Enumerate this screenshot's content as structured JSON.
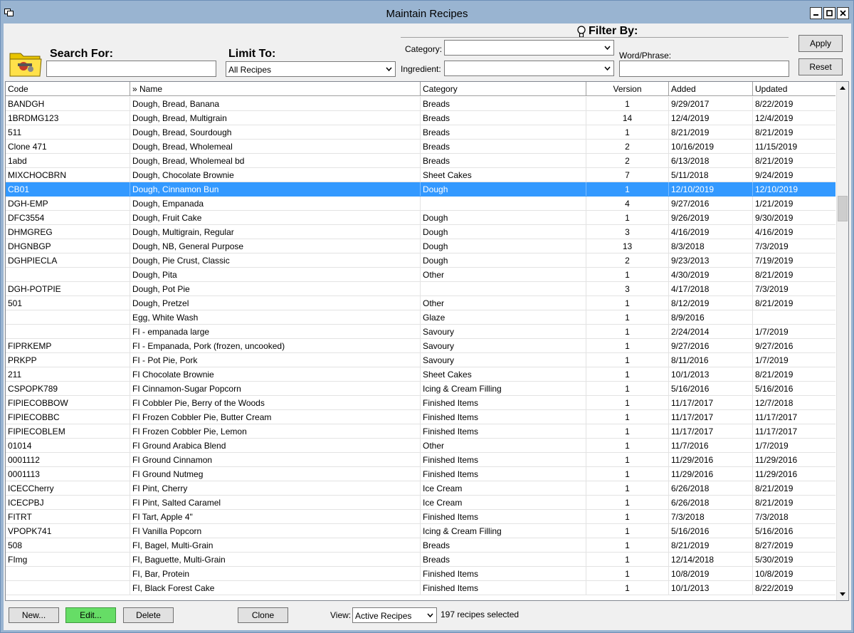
{
  "window": {
    "title": "Maintain Recipes"
  },
  "search": {
    "label": "Search For:",
    "value": ""
  },
  "limit": {
    "label": "Limit To:",
    "value": "All Recipes"
  },
  "filter": {
    "title": "Filter By:",
    "category_label": "Category:",
    "category_value": "",
    "ingredient_label": "Ingredient:",
    "ingredient_value": "",
    "word_label": "Word/Phrase:",
    "word_value": ""
  },
  "buttons": {
    "apply": "Apply",
    "reset": "Reset",
    "new": "New...",
    "edit": "Edit...",
    "delete": "Delete",
    "clone": "Clone"
  },
  "columns": {
    "code": "Code",
    "name": "» Name",
    "category": "Category",
    "version": "Version",
    "added": "Added",
    "updated": "Updated"
  },
  "rows": [
    {
      "code": "BANDGH",
      "name": "Dough, Bread, Banana",
      "category": "Breads",
      "version": "1",
      "added": "9/29/2017",
      "updated": "8/22/2019"
    },
    {
      "code": "1BRDMG123",
      "name": "Dough, Bread, Multigrain",
      "category": "Breads",
      "version": "14",
      "added": "12/4/2019",
      "updated": "12/4/2019"
    },
    {
      "code": "511",
      "name": "Dough, Bread, Sourdough",
      "category": "Breads",
      "version": "1",
      "added": "8/21/2019",
      "updated": "8/21/2019"
    },
    {
      "code": "Clone 471",
      "name": "Dough, Bread, Wholemeal",
      "category": "Breads",
      "version": "2",
      "added": "10/16/2019",
      "updated": "11/15/2019"
    },
    {
      "code": "1abd",
      "name": "Dough, Bread, Wholemeal bd",
      "category": "Breads",
      "version": "2",
      "added": "6/13/2018",
      "updated": "8/21/2019"
    },
    {
      "code": "MIXCHOCBRN",
      "name": "Dough, Chocolate Brownie",
      "category": "Sheet Cakes",
      "version": "7",
      "added": "5/11/2018",
      "updated": "9/24/2019"
    },
    {
      "code": "CB01",
      "name": "Dough, Cinnamon Bun",
      "category": "Dough",
      "version": "1",
      "added": "12/10/2019",
      "updated": "12/10/2019",
      "selected": true
    },
    {
      "code": "DGH-EMP",
      "name": "Dough, Empanada",
      "category": "",
      "version": "4",
      "added": "9/27/2016",
      "updated": "1/21/2019"
    },
    {
      "code": "DFC3554",
      "name": "Dough, Fruit Cake",
      "category": "Dough",
      "version": "1",
      "added": "9/26/2019",
      "updated": "9/30/2019"
    },
    {
      "code": "DHMGREG",
      "name": "Dough, Multigrain, Regular",
      "category": "Dough",
      "version": "3",
      "added": "4/16/2019",
      "updated": "4/16/2019"
    },
    {
      "code": "DHGNBGP",
      "name": "Dough, NB, General Purpose",
      "category": "Dough",
      "version": "13",
      "added": "8/3/2018",
      "updated": "7/3/2019"
    },
    {
      "code": "DGHPIECLA",
      "name": "Dough, Pie Crust, Classic",
      "category": "Dough",
      "version": "2",
      "added": "9/23/2013",
      "updated": "7/19/2019"
    },
    {
      "code": "",
      "name": "Dough, Pita",
      "category": "Other",
      "version": "1",
      "added": "4/30/2019",
      "updated": "8/21/2019"
    },
    {
      "code": "DGH-POTPIE",
      "name": "Dough, Pot Pie",
      "category": "",
      "version": "3",
      "added": "4/17/2018",
      "updated": "7/3/2019"
    },
    {
      "code": "501",
      "name": "Dough, Pretzel",
      "category": "Other",
      "version": "1",
      "added": "8/12/2019",
      "updated": "8/21/2019"
    },
    {
      "code": "",
      "name": "Egg, White Wash",
      "category": "Glaze",
      "version": "1",
      "added": "8/9/2016",
      "updated": ""
    },
    {
      "code": "",
      "name": "FI - empanada large",
      "category": "Savoury",
      "version": "1",
      "added": "2/24/2014",
      "updated": "1/7/2019"
    },
    {
      "code": "FIPRKEMP",
      "name": "FI - Empanada, Pork (frozen, uncooked)",
      "category": "Savoury",
      "version": "1",
      "added": "9/27/2016",
      "updated": "9/27/2016"
    },
    {
      "code": "PRKPP",
      "name": "FI - Pot Pie, Pork",
      "category": "Savoury",
      "version": "1",
      "added": "8/11/2016",
      "updated": "1/7/2019"
    },
    {
      "code": "211",
      "name": "FI Chocolate Brownie",
      "category": "Sheet Cakes",
      "version": "1",
      "added": "10/1/2013",
      "updated": "8/21/2019"
    },
    {
      "code": "CSPOPK789",
      "name": "FI Cinnamon-Sugar Popcorn",
      "category": "Icing & Cream Filling",
      "version": "1",
      "added": "5/16/2016",
      "updated": "5/16/2016"
    },
    {
      "code": "FIPIECOBBOW",
      "name": "FI Cobbler Pie, Berry of the Woods",
      "category": "Finished Items",
      "version": "1",
      "added": "11/17/2017",
      "updated": "12/7/2018"
    },
    {
      "code": "FIPIECOBBC",
      "name": "FI Frozen Cobbler Pie, Butter Cream",
      "category": "Finished Items",
      "version": "1",
      "added": "11/17/2017",
      "updated": "11/17/2017"
    },
    {
      "code": "FIPIECOBLEM",
      "name": "FI Frozen Cobbler Pie, Lemon",
      "category": "Finished Items",
      "version": "1",
      "added": "11/17/2017",
      "updated": "11/17/2017"
    },
    {
      "code": "01014",
      "name": "FI Ground Arabica Blend",
      "category": "Other",
      "version": "1",
      "added": "11/7/2016",
      "updated": "1/7/2019"
    },
    {
      "code": "0001112",
      "name": "FI Ground Cinnamon",
      "category": "Finished Items",
      "version": "1",
      "added": "11/29/2016",
      "updated": "11/29/2016"
    },
    {
      "code": "0001113",
      "name": "FI Ground Nutmeg",
      "category": "Finished Items",
      "version": "1",
      "added": "11/29/2016",
      "updated": "11/29/2016"
    },
    {
      "code": "ICECCherry",
      "name": "FI Pint, Cherry",
      "category": "Ice Cream",
      "version": "1",
      "added": "6/26/2018",
      "updated": "8/21/2019"
    },
    {
      "code": "ICECPBJ",
      "name": "FI Pint, Salted Caramel",
      "category": "Ice Cream",
      "version": "1",
      "added": "6/26/2018",
      "updated": "8/21/2019"
    },
    {
      "code": "FITRT",
      "name": "FI Tart, Apple 4\"",
      "category": "Finished Items",
      "version": "1",
      "added": "7/3/2018",
      "updated": "7/3/2018"
    },
    {
      "code": "VPOPK741",
      "name": "FI Vanilla Popcorn",
      "category": "Icing & Cream Filling",
      "version": "1",
      "added": "5/16/2016",
      "updated": "5/16/2016"
    },
    {
      "code": "508",
      "name": "FI, Bagel, Multi-Grain",
      "category": "Breads",
      "version": "1",
      "added": "8/21/2019",
      "updated": "8/27/2019"
    },
    {
      "code": "FImg",
      "name": "FI, Baguette, Multi-Grain",
      "category": "Breads",
      "version": "1",
      "added": "12/14/2018",
      "updated": "5/30/2019"
    },
    {
      "code": "",
      "name": "FI, Bar, Protein",
      "category": "Finished Items",
      "version": "1",
      "added": "10/8/2019",
      "updated": "10/8/2019"
    },
    {
      "code": "",
      "name": "FI, Black Forest Cake",
      "category": "Finished Items",
      "version": "1",
      "added": "10/1/2013",
      "updated": "8/22/2019"
    }
  ],
  "view": {
    "label": "View:",
    "value": "Active Recipes",
    "status": "197 recipes selected"
  },
  "icons": {
    "window_icon": "window-icon",
    "folder": "recipe-folder-icon",
    "bulb": "lightbulb-icon",
    "dropdown": "chevron-down-icon"
  },
  "colors": {
    "selection": "#3399ff",
    "edit_button": "#66dd66",
    "titlebar": "#99b4d1"
  }
}
